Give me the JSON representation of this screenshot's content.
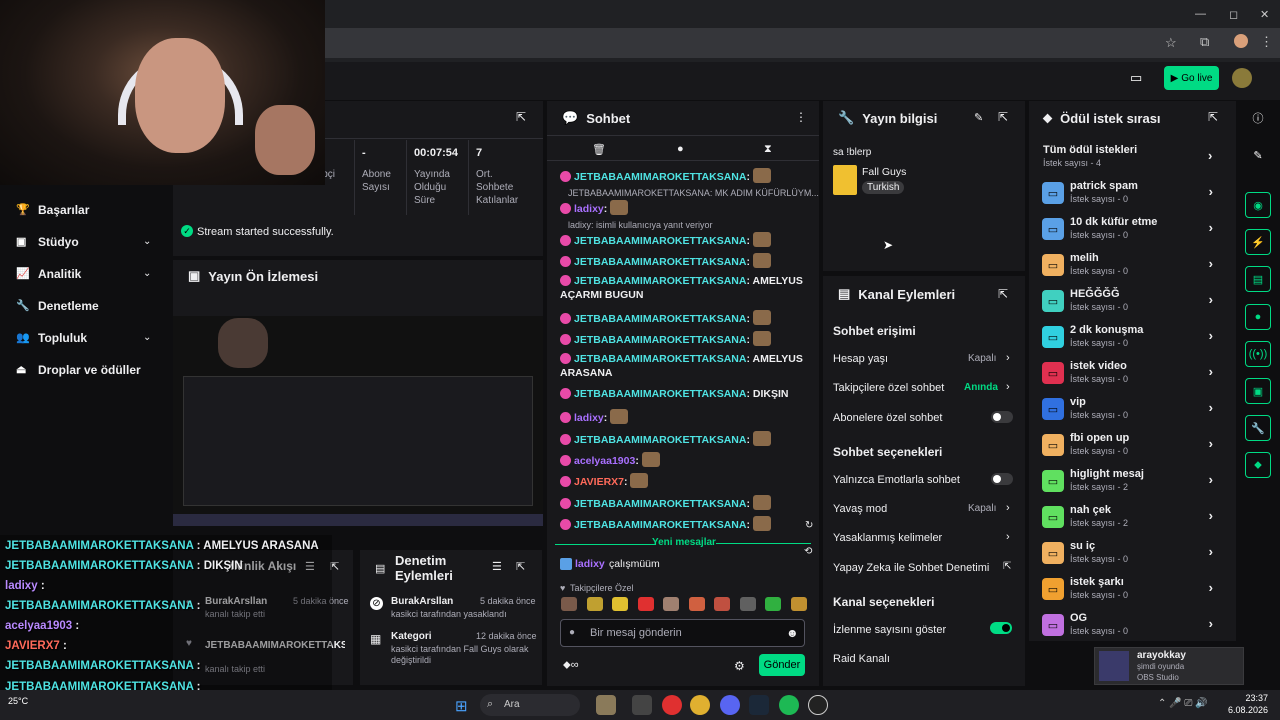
{
  "browser": {
    "controls": [
      "—",
      "◻",
      "✕"
    ]
  },
  "header": {
    "go_live": "Go live"
  },
  "leftnav": {
    "items": [
      {
        "label": "Başarılar",
        "icon": "trophy-icon",
        "glyph": "🏆"
      },
      {
        "label": "Stüdyo",
        "icon": "video-icon",
        "glyph": "▣",
        "chev": true
      },
      {
        "label": "Analitik",
        "icon": "chart-icon",
        "glyph": "📈",
        "chev": true
      },
      {
        "label": "Denetleme",
        "icon": "wrench-icon",
        "glyph": "🔧"
      },
      {
        "label": "Topluluk",
        "icon": "people-icon",
        "glyph": "👥",
        "chev": true
      },
      {
        "label": "Droplar ve ödüller",
        "icon": "drops-icon",
        "glyph": "⏏"
      }
    ]
  },
  "stats": {
    "items": [
      {
        "value": "",
        "label": "ipçi"
      },
      {
        "value": "-",
        "label": "Abone Sayısı"
      },
      {
        "value": "00:07:54",
        "label": "Yayında Olduğu Süre"
      },
      {
        "value": "7",
        "label": "Ort. Sohbete Katılanlar"
      }
    ],
    "alert": "Stream started successfully."
  },
  "preview": {
    "title": "Yayın Ön İzlemesi"
  },
  "chat": {
    "title": "Sohbet",
    "new_messages": "Yeni mesajlar",
    "followers_only": "Takipçilere Özel",
    "placeholder": "Bir mesaj gönderin",
    "send": "Gönder",
    "reply1": "JETBABAAMIMAROKETTAKSANA: MK ADIM KÜFÜRLÜYM...",
    "reply2": "ladixy: isimli kullanıcıya yanıt veriyor",
    "last_user": "ladixy",
    "last_msg": "çalışmüüm",
    "messages": [
      {
        "user": "JETBABAAMIMAROKETTAKSANA",
        "text": ""
      },
      {
        "user": "ladixy",
        "text": ""
      },
      {
        "user": "JETBABAAMIMAROKETTAKSANA",
        "text": ""
      },
      {
        "user": "JETBABAAMIMAROKETTAKSANA",
        "text": ""
      },
      {
        "user": "JETBABAAMIMAROKETTAKSANA",
        "text": "AMELYUS"
      },
      {
        "user": "",
        "text": "AÇARMI BUGUN"
      },
      {
        "user": "JETBABAAMIMAROKETTAKSANA",
        "text": ""
      },
      {
        "user": "JETBABAAMIMAROKETTAKSANA",
        "text": ""
      },
      {
        "user": "JETBABAAMIMAROKETTAKSANA",
        "text": "AMELYUS"
      },
      {
        "user": "",
        "text": "ARASANA"
      },
      {
        "user": "JETBABAAMIMAROKETTAKSANA",
        "text": "DIKŞIN"
      },
      {
        "user": "ladixy",
        "text": ""
      },
      {
        "user": "JETBABAAMIMAROKETTAKSANA",
        "text": ""
      },
      {
        "user": "acelyaa1903",
        "text": ""
      },
      {
        "user": "JAVIERX7",
        "text": ""
      },
      {
        "user": "JETBABAAMIMAROKETTAKSANA",
        "text": ""
      },
      {
        "user": "JETBABAAMIMAROKETTAKSANA",
        "text": ""
      }
    ]
  },
  "stream_info": {
    "title": "Yayın bilgisi",
    "stream_title": "sa !blerp",
    "game": "Fall Guys",
    "tag": "Turkish"
  },
  "channel_actions": {
    "title": "Kanal Eylemleri",
    "chat_access": "Sohbet erişimi",
    "account_age": "Hesap yaşı",
    "account_age_val": "Kapalı",
    "followers_chat": "Takipçilere özel sohbet",
    "followers_chat_val": "Anında",
    "subs_chat": "Abonelere özel sohbet",
    "chat_options": "Sohbet seçenekleri",
    "emote_only": "Yalnızca Emotlarla sohbet",
    "slow_mode": "Yavaş mod",
    "slow_mode_val": "Kapalı",
    "banned_words": "Yasaklanmış kelimeler",
    "ai_mod": "Yapay Zeka ile Sohbet Denetimi",
    "channel_options": "Kanal seçenekleri",
    "viewer_count": "İzlenme sayısını göster",
    "raid": "Raid Kanalı"
  },
  "rewards": {
    "title": "Ödül istek sırası",
    "all": "Tüm ödül istekleri",
    "all_count": "İstek sayısı - 4",
    "items": [
      {
        "name": "patrick spam",
        "count": "İstek sayısı - 0",
        "color": "#5aa0e6"
      },
      {
        "name": "10 dk küfür etme",
        "count": "İstek sayısı - 0",
        "color": "#5aa0e6"
      },
      {
        "name": "melih",
        "count": "İstek sayısı - 0",
        "color": "#f0b060"
      },
      {
        "name": "HEĞĞĞĞ",
        "count": "İstek sayısı - 0",
        "color": "#40d0c0"
      },
      {
        "name": "2 dk konuşma",
        "count": "İstek sayısı - 0",
        "color": "#30d0e0"
      },
      {
        "name": "istek video",
        "count": "İstek sayısı - 0",
        "color": "#e03050"
      },
      {
        "name": "vip",
        "count": "İstek sayısı - 0",
        "color": "#3070e0"
      },
      {
        "name": "fbi open up",
        "count": "İstek sayısı - 0",
        "color": "#f0b060"
      },
      {
        "name": "higlight mesaj",
        "count": "İstek sayısı - 2",
        "color": "#60e060"
      },
      {
        "name": "nah çek",
        "count": "İstek sayısı - 2",
        "color": "#60e060"
      },
      {
        "name": "su iç",
        "count": "İstek sayısı - 0",
        "color": "#f0b060"
      },
      {
        "name": "istek şarkı",
        "count": "İstek sayısı - 0",
        "color": "#f0a030"
      },
      {
        "name": "OG",
        "count": "İstek sayısı - 0",
        "color": "#c070e0"
      }
    ]
  },
  "activity": {
    "title": "tkinlik Akışı",
    "items": [
      {
        "user": "BurakArsllan",
        "time": "5 dakika önce",
        "desc": "kanalı takip etti"
      },
      {
        "user": "JETBABAAMIMAROKETTAKSANA",
        "time": "",
        "desc": ""
      },
      {
        "user": "",
        "time": "",
        "desc": "kanalı takip etti"
      }
    ]
  },
  "mod_actions": {
    "title": "Denetim Eylemleri",
    "items": [
      {
        "user": "BurakArsllan",
        "time": "5 dakika önce",
        "desc": "kasikci tarafından yasaklandı"
      },
      {
        "user": "Kategori",
        "time": "12 dakika önce",
        "desc": "kasikci tarafından Fall Guys olarak değiştirildi"
      }
    ]
  },
  "overlay": {
    "lines": [
      {
        "user": "JETBABAAMIMAROKETTAKSANA",
        "text": ": AMELYUS ARASANA"
      },
      {
        "user": "JETBABAAMIMAROKETTAKSANA",
        "text": ": DIKŞIN"
      },
      {
        "user": "ladixy",
        "text": ":"
      },
      {
        "user": "JETBABAAMIMAROKETTAKSANA",
        "text": ":"
      },
      {
        "user": "acelyaa1903",
        "text": ":"
      },
      {
        "user": "JAVIERX7",
        "text": ":"
      },
      {
        "user": "JETBABAAMIMAROKETTAKSANA",
        "text": ":"
      },
      {
        "user": "JETBABAAMIMAROKETTAKSANA",
        "text": ":"
      },
      {
        "user": "ladixy",
        "text": "çalışmüüm"
      }
    ]
  },
  "obs_popup": {
    "user": "arayokkay",
    "status": "şimdi oyunda",
    "app": "OBS Studio"
  },
  "taskbar": {
    "search": "Ara",
    "time": "23:37",
    "date": "6.08.2026",
    "weather": "25°C"
  }
}
